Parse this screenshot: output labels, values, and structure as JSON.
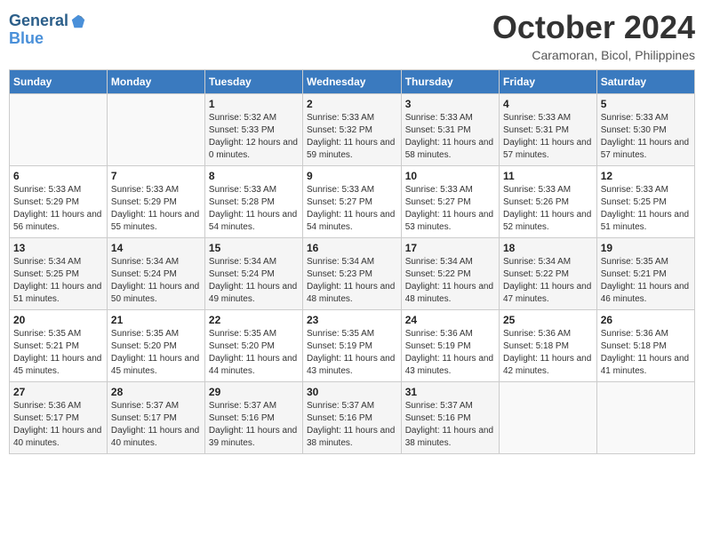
{
  "header": {
    "logo_line1": "General",
    "logo_line2": "Blue",
    "month_title": "October 2024",
    "subtitle": "Caramoran, Bicol, Philippines"
  },
  "days_of_week": [
    "Sunday",
    "Monday",
    "Tuesday",
    "Wednesday",
    "Thursday",
    "Friday",
    "Saturday"
  ],
  "weeks": [
    [
      {
        "day": "",
        "sunrise": "",
        "sunset": "",
        "daylight": ""
      },
      {
        "day": "",
        "sunrise": "",
        "sunset": "",
        "daylight": ""
      },
      {
        "day": "1",
        "sunrise": "Sunrise: 5:32 AM",
        "sunset": "Sunset: 5:33 PM",
        "daylight": "Daylight: 12 hours and 0 minutes."
      },
      {
        "day": "2",
        "sunrise": "Sunrise: 5:33 AM",
        "sunset": "Sunset: 5:32 PM",
        "daylight": "Daylight: 11 hours and 59 minutes."
      },
      {
        "day": "3",
        "sunrise": "Sunrise: 5:33 AM",
        "sunset": "Sunset: 5:31 PM",
        "daylight": "Daylight: 11 hours and 58 minutes."
      },
      {
        "day": "4",
        "sunrise": "Sunrise: 5:33 AM",
        "sunset": "Sunset: 5:31 PM",
        "daylight": "Daylight: 11 hours and 57 minutes."
      },
      {
        "day": "5",
        "sunrise": "Sunrise: 5:33 AM",
        "sunset": "Sunset: 5:30 PM",
        "daylight": "Daylight: 11 hours and 57 minutes."
      }
    ],
    [
      {
        "day": "6",
        "sunrise": "Sunrise: 5:33 AM",
        "sunset": "Sunset: 5:29 PM",
        "daylight": "Daylight: 11 hours and 56 minutes."
      },
      {
        "day": "7",
        "sunrise": "Sunrise: 5:33 AM",
        "sunset": "Sunset: 5:29 PM",
        "daylight": "Daylight: 11 hours and 55 minutes."
      },
      {
        "day": "8",
        "sunrise": "Sunrise: 5:33 AM",
        "sunset": "Sunset: 5:28 PM",
        "daylight": "Daylight: 11 hours and 54 minutes."
      },
      {
        "day": "9",
        "sunrise": "Sunrise: 5:33 AM",
        "sunset": "Sunset: 5:27 PM",
        "daylight": "Daylight: 11 hours and 54 minutes."
      },
      {
        "day": "10",
        "sunrise": "Sunrise: 5:33 AM",
        "sunset": "Sunset: 5:27 PM",
        "daylight": "Daylight: 11 hours and 53 minutes."
      },
      {
        "day": "11",
        "sunrise": "Sunrise: 5:33 AM",
        "sunset": "Sunset: 5:26 PM",
        "daylight": "Daylight: 11 hours and 52 minutes."
      },
      {
        "day": "12",
        "sunrise": "Sunrise: 5:33 AM",
        "sunset": "Sunset: 5:25 PM",
        "daylight": "Daylight: 11 hours and 51 minutes."
      }
    ],
    [
      {
        "day": "13",
        "sunrise": "Sunrise: 5:34 AM",
        "sunset": "Sunset: 5:25 PM",
        "daylight": "Daylight: 11 hours and 51 minutes."
      },
      {
        "day": "14",
        "sunrise": "Sunrise: 5:34 AM",
        "sunset": "Sunset: 5:24 PM",
        "daylight": "Daylight: 11 hours and 50 minutes."
      },
      {
        "day": "15",
        "sunrise": "Sunrise: 5:34 AM",
        "sunset": "Sunset: 5:24 PM",
        "daylight": "Daylight: 11 hours and 49 minutes."
      },
      {
        "day": "16",
        "sunrise": "Sunrise: 5:34 AM",
        "sunset": "Sunset: 5:23 PM",
        "daylight": "Daylight: 11 hours and 48 minutes."
      },
      {
        "day": "17",
        "sunrise": "Sunrise: 5:34 AM",
        "sunset": "Sunset: 5:22 PM",
        "daylight": "Daylight: 11 hours and 48 minutes."
      },
      {
        "day": "18",
        "sunrise": "Sunrise: 5:34 AM",
        "sunset": "Sunset: 5:22 PM",
        "daylight": "Daylight: 11 hours and 47 minutes."
      },
      {
        "day": "19",
        "sunrise": "Sunrise: 5:35 AM",
        "sunset": "Sunset: 5:21 PM",
        "daylight": "Daylight: 11 hours and 46 minutes."
      }
    ],
    [
      {
        "day": "20",
        "sunrise": "Sunrise: 5:35 AM",
        "sunset": "Sunset: 5:21 PM",
        "daylight": "Daylight: 11 hours and 45 minutes."
      },
      {
        "day": "21",
        "sunrise": "Sunrise: 5:35 AM",
        "sunset": "Sunset: 5:20 PM",
        "daylight": "Daylight: 11 hours and 45 minutes."
      },
      {
        "day": "22",
        "sunrise": "Sunrise: 5:35 AM",
        "sunset": "Sunset: 5:20 PM",
        "daylight": "Daylight: 11 hours and 44 minutes."
      },
      {
        "day": "23",
        "sunrise": "Sunrise: 5:35 AM",
        "sunset": "Sunset: 5:19 PM",
        "daylight": "Daylight: 11 hours and 43 minutes."
      },
      {
        "day": "24",
        "sunrise": "Sunrise: 5:36 AM",
        "sunset": "Sunset: 5:19 PM",
        "daylight": "Daylight: 11 hours and 43 minutes."
      },
      {
        "day": "25",
        "sunrise": "Sunrise: 5:36 AM",
        "sunset": "Sunset: 5:18 PM",
        "daylight": "Daylight: 11 hours and 42 minutes."
      },
      {
        "day": "26",
        "sunrise": "Sunrise: 5:36 AM",
        "sunset": "Sunset: 5:18 PM",
        "daylight": "Daylight: 11 hours and 41 minutes."
      }
    ],
    [
      {
        "day": "27",
        "sunrise": "Sunrise: 5:36 AM",
        "sunset": "Sunset: 5:17 PM",
        "daylight": "Daylight: 11 hours and 40 minutes."
      },
      {
        "day": "28",
        "sunrise": "Sunrise: 5:37 AM",
        "sunset": "Sunset: 5:17 PM",
        "daylight": "Daylight: 11 hours and 40 minutes."
      },
      {
        "day": "29",
        "sunrise": "Sunrise: 5:37 AM",
        "sunset": "Sunset: 5:16 PM",
        "daylight": "Daylight: 11 hours and 39 minutes."
      },
      {
        "day": "30",
        "sunrise": "Sunrise: 5:37 AM",
        "sunset": "Sunset: 5:16 PM",
        "daylight": "Daylight: 11 hours and 38 minutes."
      },
      {
        "day": "31",
        "sunrise": "Sunrise: 5:37 AM",
        "sunset": "Sunset: 5:16 PM",
        "daylight": "Daylight: 11 hours and 38 minutes."
      },
      {
        "day": "",
        "sunrise": "",
        "sunset": "",
        "daylight": ""
      },
      {
        "day": "",
        "sunrise": "",
        "sunset": "",
        "daylight": ""
      }
    ]
  ]
}
